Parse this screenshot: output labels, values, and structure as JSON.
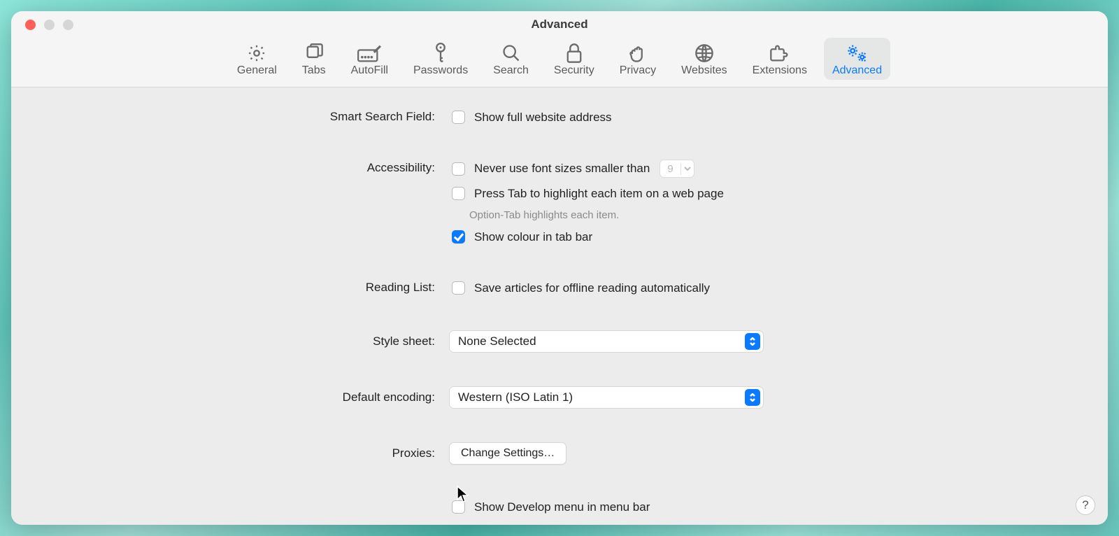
{
  "window": {
    "title": "Advanced"
  },
  "tabs": [
    {
      "id": "general",
      "label": "General"
    },
    {
      "id": "tabs",
      "label": "Tabs"
    },
    {
      "id": "autofill",
      "label": "AutoFill"
    },
    {
      "id": "passwords",
      "label": "Passwords"
    },
    {
      "id": "search",
      "label": "Search"
    },
    {
      "id": "security",
      "label": "Security"
    },
    {
      "id": "privacy",
      "label": "Privacy"
    },
    {
      "id": "websites",
      "label": "Websites"
    },
    {
      "id": "extensions",
      "label": "Extensions"
    },
    {
      "id": "advanced",
      "label": "Advanced"
    }
  ],
  "smart_search": {
    "label": "Smart Search Field:",
    "show_full_address": {
      "label": "Show full website address",
      "checked": false
    }
  },
  "accessibility": {
    "label": "Accessibility:",
    "min_font": {
      "label": "Never use font sizes smaller than",
      "checked": false,
      "value": "9"
    },
    "press_tab": {
      "label": "Press Tab to highlight each item on a web page",
      "checked": false
    },
    "hint": "Option-Tab highlights each item.",
    "tab_colour": {
      "label": "Show colour in tab bar",
      "checked": true
    }
  },
  "reading_list": {
    "label": "Reading List:",
    "save_offline": {
      "label": "Save articles for offline reading automatically",
      "checked": false
    }
  },
  "style_sheet": {
    "label": "Style sheet:",
    "value": "None Selected"
  },
  "default_encoding": {
    "label": "Default encoding:",
    "value": "Western (ISO Latin 1)"
  },
  "proxies": {
    "label": "Proxies:",
    "button": "Change Settings…"
  },
  "develop": {
    "label": "Show Develop menu in menu bar",
    "checked": false
  },
  "help": "?"
}
